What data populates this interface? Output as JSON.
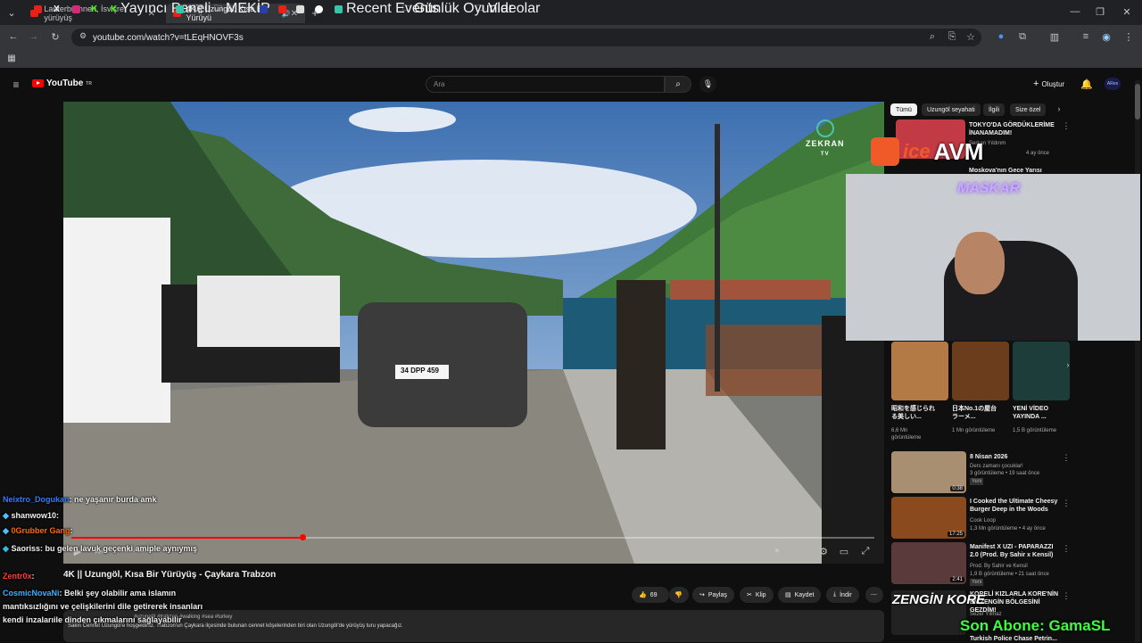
{
  "browser": {
    "tabs": [
      {
        "title": "Lauterbrunnen, İsviçre yürüyüş"
      },
      {
        "title": "4K || Uzungöl, Kısa Bir Yürüyü"
      }
    ],
    "url": "youtube.com/watch?v=tLEqHNOVF3s",
    "bookmarks": [
      "Yayıncı Paneli",
      "MEKİP",
      "Recent Events",
      "Günlük Oyunlar",
      "Videolar"
    ]
  },
  "youtube": {
    "logo": "YouTube",
    "logo_sup": "TR",
    "search_placeholder": "Ara",
    "create_label": "Oluştur",
    "avatar_label": "ARes"
  },
  "video": {
    "title": "4K || Uzungöl, Kısa Bir Yürüyüş - Çaykara Trabzon",
    "channel_watermark": "ZEKRAN",
    "channel_watermark_sub": "TV",
    "plate": "34 DPP 459",
    "time": "4:06 / 18:43",
    "actions": {
      "likes": "69",
      "share": "Paylaş",
      "clip": "Klip",
      "save": "Kaydet",
      "download": "İndir"
    },
    "description_tags": "#uzungöl #trabzon #walking #sea #turkey",
    "description": "Sakin Cennet Uzungöl'e hoşgeldiniz. Trabzon'un Çaykara ilçesinde bulunan cennet köşelerinden biri olan Uzungöl'de yürüyüş turu yapacağız."
  },
  "sidebar": {
    "chips": [
      "Tümü",
      "Uzungöl seyahati",
      "İlgili",
      "Size özel"
    ],
    "top_video": {
      "title": "TOKYO'DA GÖRDÜKLERİME İNANAMADIM!",
      "meta": "Serkan Yıldırım",
      "age": "4 ay önce"
    },
    "second_video": {
      "title": "Moskova'nın Gece Yarısı"
    },
    "shorts": [
      {
        "title": "昭和を感じられる美しい...",
        "views": "6,6 Mn görüntüleme"
      },
      {
        "title": "日本No.1の屋台ラーメ...",
        "views": "1 Mn görüntüleme"
      },
      {
        "title": "YENİ VİDEO YAYINDA ...",
        "views": "1,5 B görüntüleme"
      }
    ],
    "videos": [
      {
        "title": "8 Nisan 2026",
        "channel": "Ders zamanı çocuklar!",
        "meta": "3 görüntüleme • 19 saat önce",
        "badge": "Yeni",
        "dur": "0:38"
      },
      {
        "title": "I Cooked the Ultimate Cheesy Burger Deep in the Woods",
        "channel": "Cook Loop",
        "meta": "1,3 Mn görüntüleme • 4 ay önce",
        "badge": "",
        "dur": "17:25"
      },
      {
        "title": "Manifest X UZI - PAPARAZZI 2.0 (Prod. By Sahir x Kensil)",
        "channel": "Prod. By Sahir ve Kensil",
        "meta": "1,9 B görüntüleme • 21 saat önce",
        "badge": "Yeni",
        "dur": "2:41"
      },
      {
        "title": "KORELİ KIZLARLA KORE'NİN EN ZENGİN BÖLGESİNİ GEZDİM!",
        "channel": "Sezer Yılmaz",
        "meta": "",
        "badge": "",
        "dur": ""
      },
      {
        "title": "Turkish Police Chase Petrin...",
        "channel": "",
        "meta": "",
        "badge": "",
        "dur": ""
      }
    ]
  },
  "overlay": {
    "banner": "AVM",
    "banner_prefix": "ice",
    "webcam_name": "MASKAR",
    "last_sub": "Son Abone: GamaSL",
    "chat": [
      {
        "user": "Neixtro_Dogukan",
        "msg": ": ne yaşanır burda amk",
        "color": "#2e7bff"
      },
      {
        "user": "shanwow10",
        "msg": ":",
        "color": "#ffffff"
      },
      {
        "user": "0Grubber Gang",
        "msg": ":",
        "color": "#ff6a00"
      },
      {
        "user": "Saoriss",
        "msg": ": bu gelen lavuk geçenki amiple aynıymış",
        "color": "#ffffff"
      },
      {
        "user": "Zentr0x",
        "msg": ":",
        "color": "#ff3b3b"
      },
      {
        "user": "CosmicNovaNi",
        "msg": ": Belki şey olabilir ama islamın mantıksızlığını ve çelişkilerini dile getirerek insanları kendi inzalarıile dinden çıkmalarını sağlayabilir",
        "color": "#3bb0ff"
      }
    ]
  },
  "colors": {
    "accent": "#ff0000",
    "chip_active": "#f1f1f1",
    "sub_banner": "#3cff3c"
  }
}
